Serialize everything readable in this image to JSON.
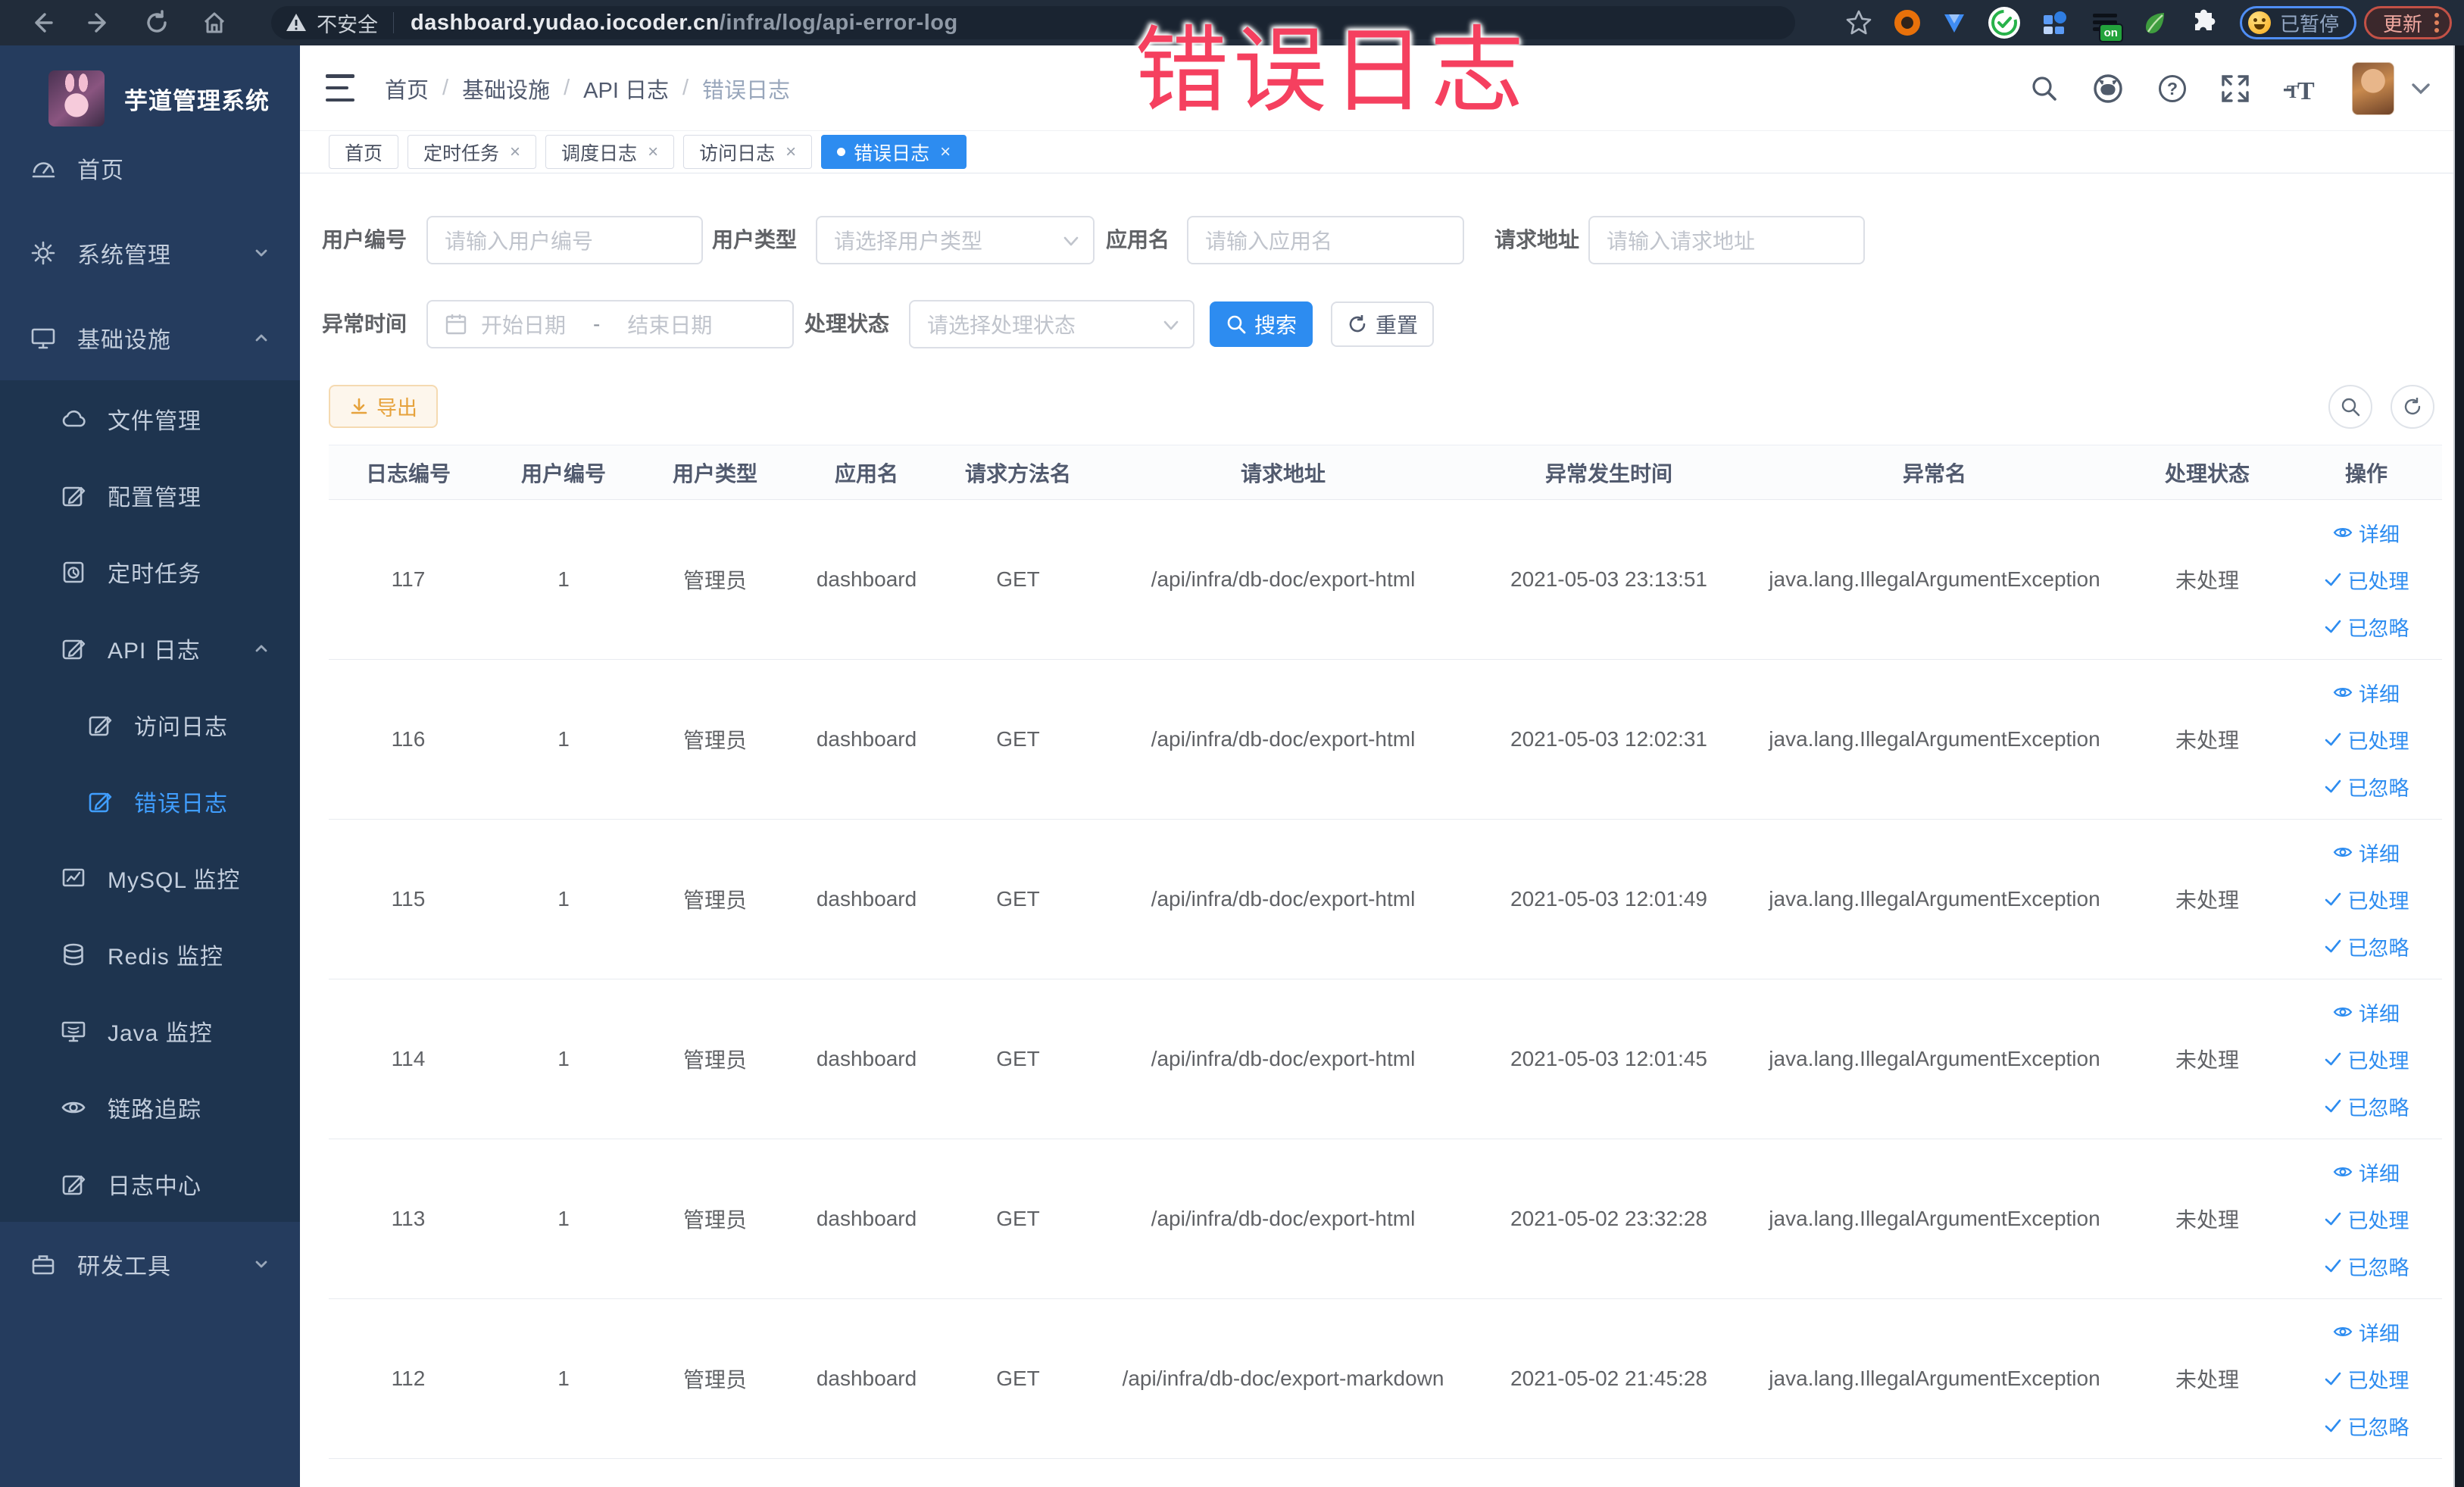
{
  "chrome": {
    "security_label": "不安全",
    "url_domain": "dashboard.yudao.iocoder.cn",
    "url_path": "/infra/log/api-error-log",
    "paused_badge": "已暂停",
    "update_button": "更新"
  },
  "annotation": {
    "text": "错误日志",
    "color": "#ee3d59"
  },
  "sidebar": {
    "logo_title": "芋道管理系统",
    "items": [
      {
        "label": "首页",
        "depth": 1,
        "icon": "gauge-icon",
        "zone": "top"
      },
      {
        "label": "系统管理",
        "depth": 1,
        "icon": "gear-icon",
        "chevron": "down",
        "zone": "top"
      },
      {
        "label": "基础设施",
        "depth": 1,
        "icon": "monitor-icon",
        "chevron": "up",
        "zone": "top"
      },
      {
        "label": "文件管理",
        "depth": 2,
        "icon": "cloud-icon",
        "zone": "sub"
      },
      {
        "label": "配置管理",
        "depth": 2,
        "icon": "edit-icon",
        "zone": "sub"
      },
      {
        "label": "定时任务",
        "depth": 2,
        "icon": "task-clock-icon",
        "zone": "sub"
      },
      {
        "label": "API 日志",
        "depth": 2,
        "icon": "edit-icon",
        "chevron": "up",
        "zone": "sub"
      },
      {
        "label": "访问日志",
        "depth": 3,
        "icon": "edit-icon",
        "zone": "sub"
      },
      {
        "label": "错误日志",
        "depth": 3,
        "icon": "edit-icon",
        "active": true,
        "zone": "sub"
      },
      {
        "label": "MySQL 监控",
        "depth": 2,
        "icon": "chart-box-icon",
        "zone": "sub"
      },
      {
        "label": "Redis 监控",
        "depth": 2,
        "icon": "database-icon",
        "zone": "sub"
      },
      {
        "label": "Java 监控",
        "depth": 2,
        "icon": "java-monitor-icon",
        "zone": "sub"
      },
      {
        "label": "链路追踪",
        "depth": 2,
        "icon": "eye-icon",
        "zone": "sub"
      },
      {
        "label": "日志中心",
        "depth": 2,
        "icon": "edit-icon",
        "zone": "sub"
      },
      {
        "label": "研发工具",
        "depth": 1,
        "icon": "briefcase-icon",
        "chevron": "down",
        "zone": "bottom"
      }
    ]
  },
  "header": {
    "breadcrumb": [
      "首页",
      "基础设施",
      "API 日志",
      "错误日志"
    ]
  },
  "tabs": [
    {
      "label": "首页",
      "closable": false,
      "active": false
    },
    {
      "label": "定时任务",
      "closable": true,
      "active": false
    },
    {
      "label": "调度日志",
      "closable": true,
      "active": false
    },
    {
      "label": "访问日志",
      "closable": true,
      "active": false
    },
    {
      "label": "错误日志",
      "closable": true,
      "active": true
    }
  ],
  "filters": {
    "user_id": {
      "label": "用户编号",
      "placeholder": "请输入用户编号"
    },
    "user_type": {
      "label": "用户类型",
      "placeholder": "请选择用户类型"
    },
    "app_name": {
      "label": "应用名",
      "placeholder": "请输入应用名"
    },
    "request_url": {
      "label": "请求地址",
      "placeholder": "请输入请求地址"
    },
    "exception_time": {
      "label": "异常时间",
      "start_placeholder": "开始日期",
      "separator": "-",
      "end_placeholder": "结束日期"
    },
    "process_status": {
      "label": "处理状态",
      "placeholder": "请选择处理状态"
    },
    "search_button": "搜索",
    "reset_button": "重置"
  },
  "toolbar": {
    "export_button": "导出"
  },
  "table": {
    "columns": [
      "日志编号",
      "用户编号",
      "用户类型",
      "应用名",
      "请求方法名",
      "请求地址",
      "异常发生时间",
      "异常名",
      "处理状态",
      "操作"
    ],
    "row_actions": [
      "详细",
      "已处理",
      "已忽略"
    ],
    "rows": [
      {
        "id": "117",
        "user_id": "1",
        "user_type": "管理员",
        "app": "dashboard",
        "method": "GET",
        "url": "/api/infra/db-doc/export-html",
        "time": "2021-05-03 23:13:51",
        "exception": "java.lang.IllegalArgumentException",
        "status": "未处理"
      },
      {
        "id": "116",
        "user_id": "1",
        "user_type": "管理员",
        "app": "dashboard",
        "method": "GET",
        "url": "/api/infra/db-doc/export-html",
        "time": "2021-05-03 12:02:31",
        "exception": "java.lang.IllegalArgumentException",
        "status": "未处理"
      },
      {
        "id": "115",
        "user_id": "1",
        "user_type": "管理员",
        "app": "dashboard",
        "method": "GET",
        "url": "/api/infra/db-doc/export-html",
        "time": "2021-05-03 12:01:49",
        "exception": "java.lang.IllegalArgumentException",
        "status": "未处理"
      },
      {
        "id": "114",
        "user_id": "1",
        "user_type": "管理员",
        "app": "dashboard",
        "method": "GET",
        "url": "/api/infra/db-doc/export-html",
        "time": "2021-05-03 12:01:45",
        "exception": "java.lang.IllegalArgumentException",
        "status": "未处理"
      },
      {
        "id": "113",
        "user_id": "1",
        "user_type": "管理员",
        "app": "dashboard",
        "method": "GET",
        "url": "/api/infra/db-doc/export-html",
        "time": "2021-05-02 23:32:28",
        "exception": "java.lang.IllegalArgumentException",
        "status": "未处理"
      },
      {
        "id": "112",
        "user_id": "1",
        "user_type": "管理员",
        "app": "dashboard",
        "method": "GET",
        "url": "/api/infra/db-doc/export-markdown",
        "time": "2021-05-02 21:45:28",
        "exception": "java.lang.IllegalArgumentException",
        "status": "未处理"
      }
    ]
  }
}
